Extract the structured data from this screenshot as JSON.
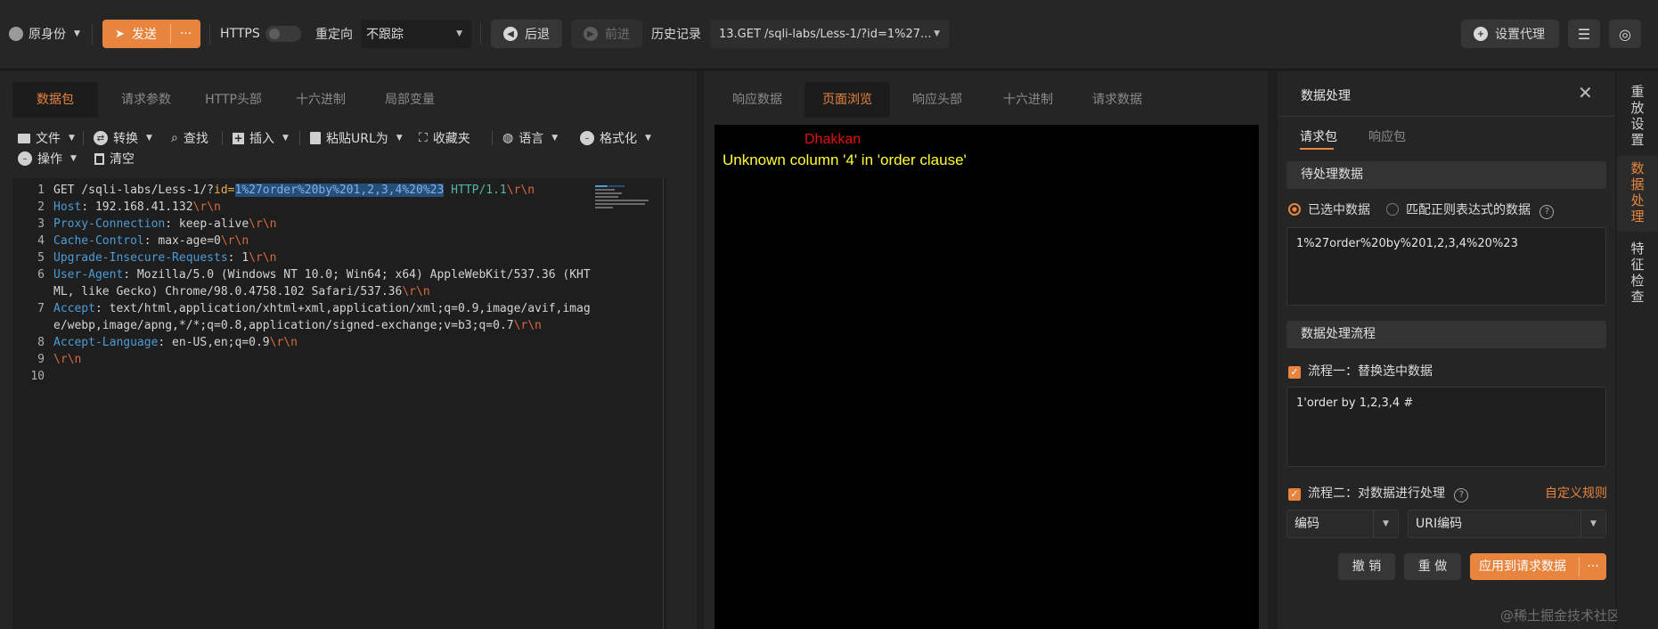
{
  "toolbar": {
    "identity": "原身份",
    "send": "发送",
    "more": "···",
    "https": "HTTPS",
    "redirect_label": "重定向",
    "redirect_value": "不跟踪",
    "back": "后退",
    "forward": "前进",
    "history_label": "历史记录",
    "history_value": "13.GET /sqli-labs/Less-1/?id=1%27...",
    "proxy": "设置代理"
  },
  "request": {
    "tabs": [
      "数据包",
      "请求参数",
      "HTTP头部",
      "十六进制",
      "局部变量"
    ],
    "menu": {
      "file": "文件",
      "convert": "转换",
      "find": "查找",
      "insert": "插入",
      "paste_url": "粘贴URL为",
      "favorites": "收藏夹",
      "language": "语言",
      "format": "格式化",
      "operation": "操作",
      "clear": "清空"
    },
    "lines": [
      {
        "n": "1",
        "a": "GET /sqli-labs/Less-1/?",
        "b": "id=",
        "sel": "1%27order%20by%201,2,3,4%20%23",
        "c": " HTTP/1.1",
        "crlf": "\\r\\n"
      },
      {
        "n": "2",
        "key": "Host",
        "val": ": 192.168.41.132",
        "crlf": "\\r\\n"
      },
      {
        "n": "3",
        "key": "Proxy-Connection",
        "val": ": keep-alive",
        "crlf": "\\r\\n"
      },
      {
        "n": "4",
        "key": "Cache-Control",
        "val": ": max-age=0",
        "crlf": "\\r\\n"
      },
      {
        "n": "5",
        "key": "Upgrade-Insecure-Requests",
        "val": ": 1",
        "crlf": "\\r\\n"
      },
      {
        "n": "6",
        "key": "User-Agent",
        "val": ": Mozilla/5.0 (Windows NT 10.0; Win64; x64) AppleWebKit/537.36 (KHT"
      },
      {
        "n": "",
        "val": "ML, like Gecko) Chrome/98.0.4758.102 Safari/537.36",
        "crlf": "\\r\\n"
      },
      {
        "n": "7",
        "key": "Accept",
        "val": ": text/html,application/xhtml+xml,application/xml;q=0.9,image/avif,imag"
      },
      {
        "n": "",
        "val": "e/webp,image/apng,*/*;q=0.8,application/signed-exchange;v=b3;q=0.7",
        "crlf": "\\r\\n"
      },
      {
        "n": "8",
        "key": "Accept-Language",
        "val": ": en-US,en;q=0.9",
        "crlf": "\\r\\n"
      },
      {
        "n": "9",
        "crlf": "\\r\\n"
      },
      {
        "n": "10"
      }
    ]
  },
  "response": {
    "tabs": [
      "响应数据",
      "页面浏览",
      "响应头部",
      "十六进制",
      "请求数据"
    ],
    "page_title": "Dhakkan",
    "page_error": "Unknown column '4' in 'order clause'"
  },
  "processing": {
    "title": "数据处理",
    "tabs": [
      "请求包",
      "响应包"
    ],
    "pending_section": "待处理数据",
    "radio_selected": "已选中数据",
    "radio_regex": "匹配正则表达式的数据",
    "pending_value": "1%27order%20by%201,2,3,4%20%23",
    "flow_section": "数据处理流程",
    "step1_label": "流程一：替换选中数据",
    "step1_value": "1'order by 1,2,3,4 #",
    "step2_label": "流程二：对数据进行处理",
    "custom_rule": "自定义规则",
    "select_mode": "编码",
    "select_method": "URI编码",
    "undo": "撤 销",
    "redo": "重 做",
    "apply": "应用到请求数据",
    "apply_more": "···"
  },
  "sidebar": {
    "items": [
      "重放设置",
      "数据处理",
      "特征检查"
    ]
  },
  "watermark": "@稀土掘金技术社区",
  "colors": {
    "accent": "#e8843e",
    "selection": "#264f78"
  }
}
